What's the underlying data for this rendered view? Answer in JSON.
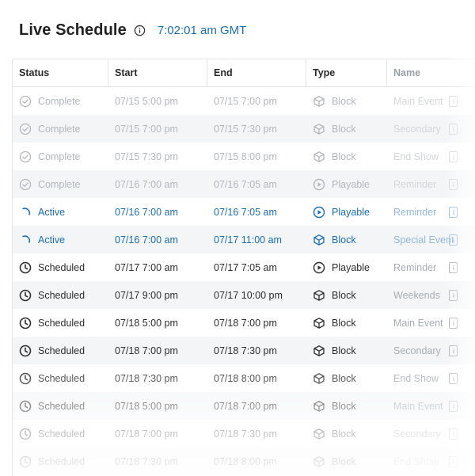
{
  "header": {
    "title": "Live Schedule",
    "clock": "7:02:01 am GMT"
  },
  "columns": [
    "Status",
    "Start",
    "End",
    "Type",
    "Name"
  ],
  "status_icons": {
    "Complete": "check-circle-icon",
    "Active": "spinner-icon",
    "Scheduled": "clock-icon"
  },
  "type_icons": {
    "Block": "cube-icon",
    "Playable": "play-circle-icon"
  },
  "colors": {
    "active": "#1a6fb5",
    "complete": "#b3b7bc",
    "scheduled": "#2e2e2e"
  },
  "rows": [
    {
      "status": "Complete",
      "start": "07/15 5:00 pm",
      "end": "07/15 7:00 pm",
      "type": "Block",
      "name": "Main Event"
    },
    {
      "status": "Complete",
      "start": "07/15 7:00 pm",
      "end": "07/15 7:30 pm",
      "type": "Block",
      "name": "Secondary"
    },
    {
      "status": "Complete",
      "start": "07/15 7:30 pm",
      "end": "07/15 8:00 pm",
      "type": "Block",
      "name": "End Show"
    },
    {
      "status": "Complete",
      "start": "07/16 7:00 am",
      "end": "07/16 7:05 am",
      "type": "Playable",
      "name": "Reminder"
    },
    {
      "status": "Active",
      "start": "07/16 7:00 am",
      "end": "07/16 7:05 am",
      "type": "Playable",
      "name": "Reminder"
    },
    {
      "status": "Active",
      "start": "07/16 7:00 am",
      "end": "07/17 11:00 am",
      "type": "Block",
      "name": "Special Event"
    },
    {
      "status": "Scheduled",
      "start": "07/17 7:00 am",
      "end": "07/17 7:05 am",
      "type": "Playable",
      "name": "Reminder"
    },
    {
      "status": "Scheduled",
      "start": "07/17 9:00 pm",
      "end": "07/17 10:00 pm",
      "type": "Block",
      "name": "Weekends"
    },
    {
      "status": "Scheduled",
      "start": "07/18 5:00 pm",
      "end": "07/18 7:00 pm",
      "type": "Block",
      "name": "Main Event"
    },
    {
      "status": "Scheduled",
      "start": "07/18 7:00 pm",
      "end": "07/18 7:30 pm",
      "type": "Block",
      "name": "Secondary"
    },
    {
      "status": "Scheduled",
      "start": "07/18 7:30 pm",
      "end": "07/18 8:00 pm",
      "type": "Block",
      "name": "End Show"
    },
    {
      "status": "Scheduled",
      "start": "07/18 5:00 pm",
      "end": "07/18 7:00 pm",
      "type": "Block",
      "name": "Main Event"
    },
    {
      "status": "Scheduled",
      "start": "07/18 7:00 pm",
      "end": "07/18 7:30 pm",
      "type": "Block",
      "name": "Secondary"
    },
    {
      "status": "Scheduled",
      "start": "07/18 7:30 pm",
      "end": "07/18 8:00 pm",
      "type": "Block",
      "name": "End Show"
    }
  ]
}
